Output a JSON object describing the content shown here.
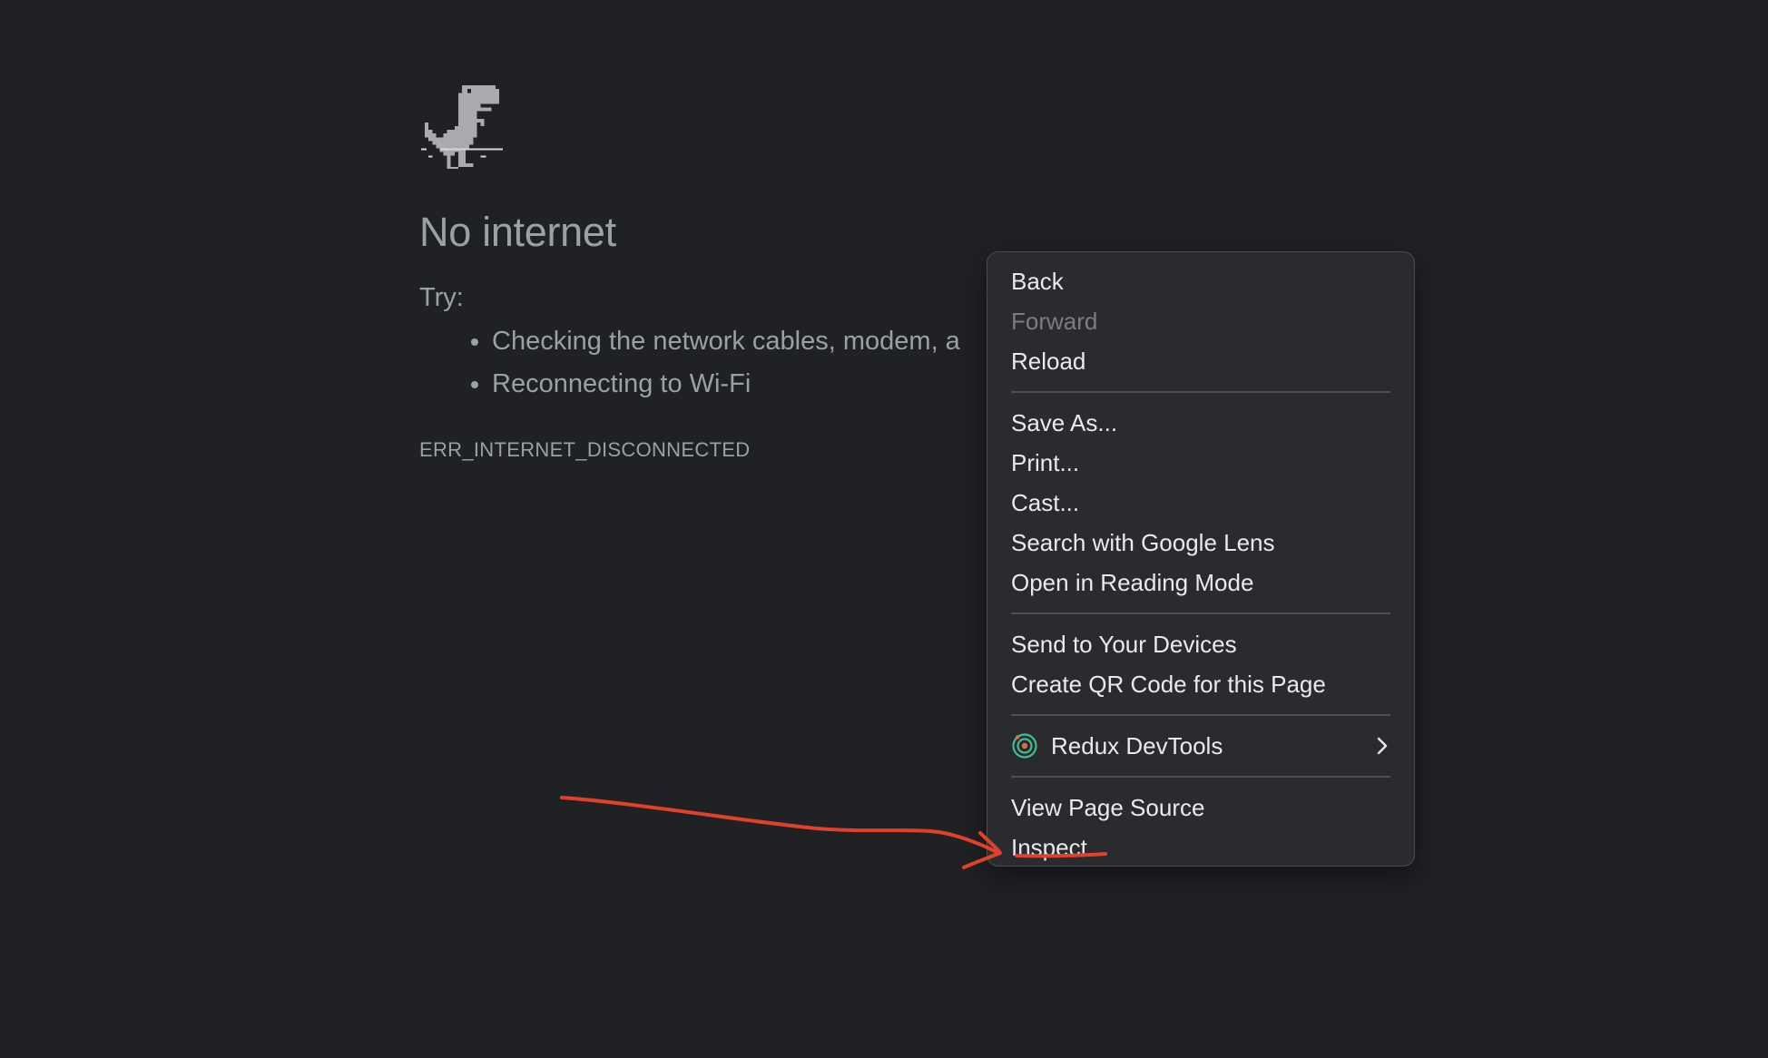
{
  "error_page": {
    "heading": "No internet",
    "try_label": "Try:",
    "suggestions": [
      "Checking the network cables, modem, a",
      "Reconnecting to Wi-Fi"
    ],
    "error_code": "ERR_INTERNET_DISCONNECTED"
  },
  "context_menu": {
    "groups": [
      [
        {
          "label": "Back",
          "enabled": true
        },
        {
          "label": "Forward",
          "enabled": false
        },
        {
          "label": "Reload",
          "enabled": true
        }
      ],
      [
        {
          "label": "Save As...",
          "enabled": true
        },
        {
          "label": "Print...",
          "enabled": true
        },
        {
          "label": "Cast...",
          "enabled": true
        },
        {
          "label": "Search with Google Lens",
          "enabled": true
        },
        {
          "label": "Open in Reading Mode",
          "enabled": true
        }
      ],
      [
        {
          "label": "Send to Your Devices",
          "enabled": true
        },
        {
          "label": "Create QR Code for this Page",
          "enabled": true
        }
      ],
      [
        {
          "label": "Redux DevTools",
          "enabled": true,
          "icon": "redux-devtools-icon",
          "submenu": true
        }
      ],
      [
        {
          "label": "View Page Source",
          "enabled": true
        },
        {
          "label": "Inspect",
          "enabled": true,
          "highlighted": true
        }
      ]
    ]
  },
  "annotation": {
    "color": "#e0412b",
    "target": "Inspect"
  },
  "colors": {
    "background": "#202124",
    "text_muted": "#9aa0a6",
    "menu_background": "#2a2b2e",
    "menu_text": "#e8eaed",
    "menu_disabled": "#7b7d80"
  }
}
